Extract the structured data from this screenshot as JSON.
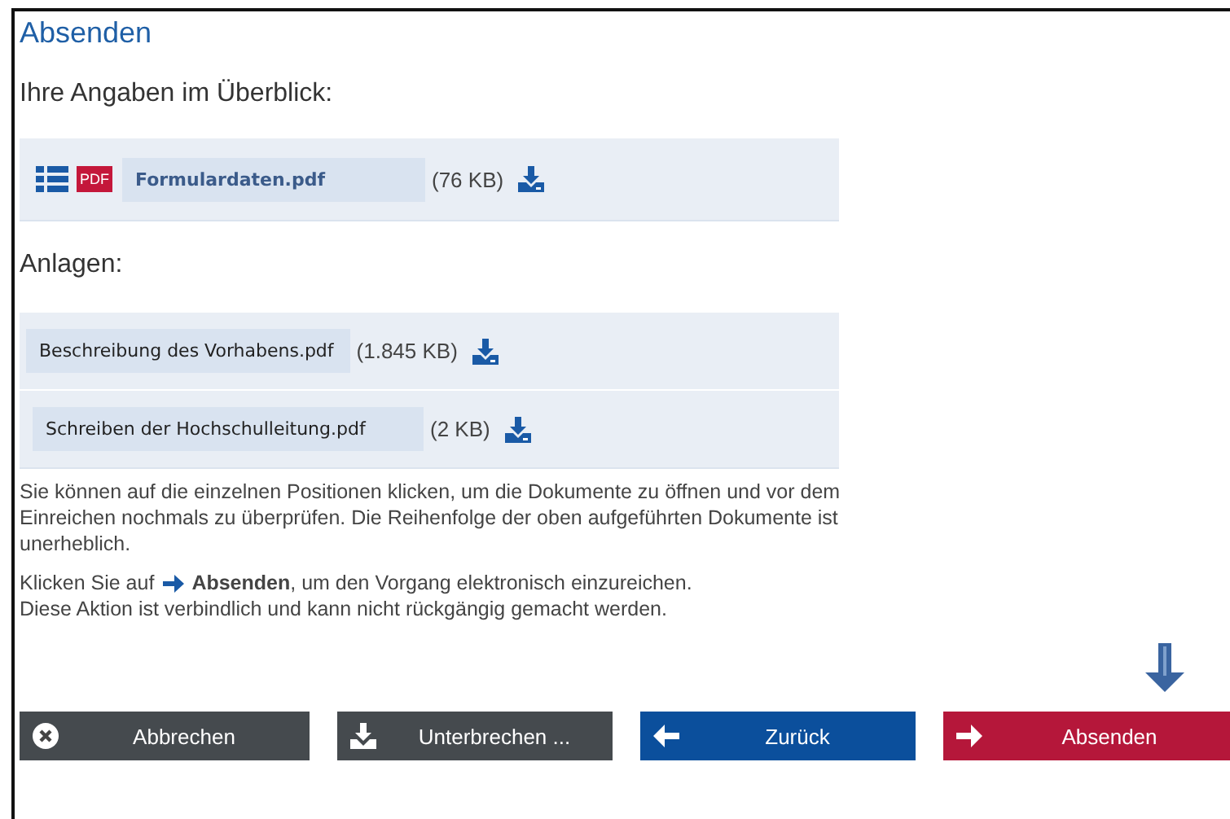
{
  "title": "Absenden",
  "overview": {
    "heading": "Ihre Angaben im Überblick:",
    "file": {
      "name": "Formulardaten.pdf",
      "badge": "PDF",
      "size": "(76 KB)"
    }
  },
  "attachments": {
    "heading": "Anlagen:",
    "files": [
      {
        "name": "Beschreibung des Vorhabens.pdf",
        "size": "(1.845 KB)"
      },
      {
        "name": "Schreiben der Hochschulleitung.pdf",
        "size": "(2 KB)"
      }
    ]
  },
  "info": "Sie können auf die einzelnen Positionen klicken, um die Dokumente zu öffnen und vor dem Einreichen nochmals zu überprüfen. Die Reihenfolge der oben aufgeführten Dokumente ist unerheblich.",
  "instruction": {
    "lead": "Klicken Sie auf",
    "rest": "**Absenden**, um den Vorgang elektronisch einzureichen.",
    "second": "Diese Aktion ist verbindlich und kann nicht rückgängig gemacht werden."
  },
  "buttons": [
    {
      "kind": "cancel",
      "label": "Abbrechen"
    },
    {
      "kind": "pause",
      "label": "Unterbrechen ..."
    },
    {
      "kind": "back",
      "label": "Zurück"
    },
    {
      "kind": "submit",
      "label": "Absenden"
    }
  ]
}
